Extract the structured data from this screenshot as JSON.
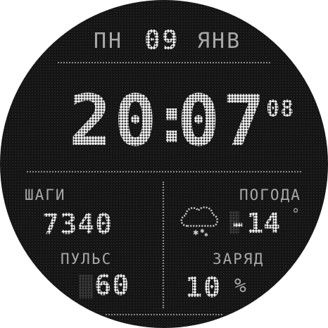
{
  "date": {
    "weekday": "ПН",
    "day": "09",
    "month": "ЯНВ"
  },
  "time": {
    "hours": "20",
    "separator": ":",
    "minutes": "07",
    "seconds": "08"
  },
  "steps": {
    "label": "ШАГИ",
    "value": "7340"
  },
  "pulse": {
    "label": "ПУЛЬС",
    "value": "60"
  },
  "weather": {
    "label": "ПОГОДА",
    "value": "-14",
    "unit": "°",
    "icon": "snow-cloud-icon"
  },
  "battery": {
    "label": "ЗАРЯД",
    "value": "10",
    "unit": "%"
  },
  "colors": {
    "background": "#141414",
    "primary": "#ffffff",
    "secondary": "#a8a8a8",
    "divider": "#8a8a8a"
  }
}
